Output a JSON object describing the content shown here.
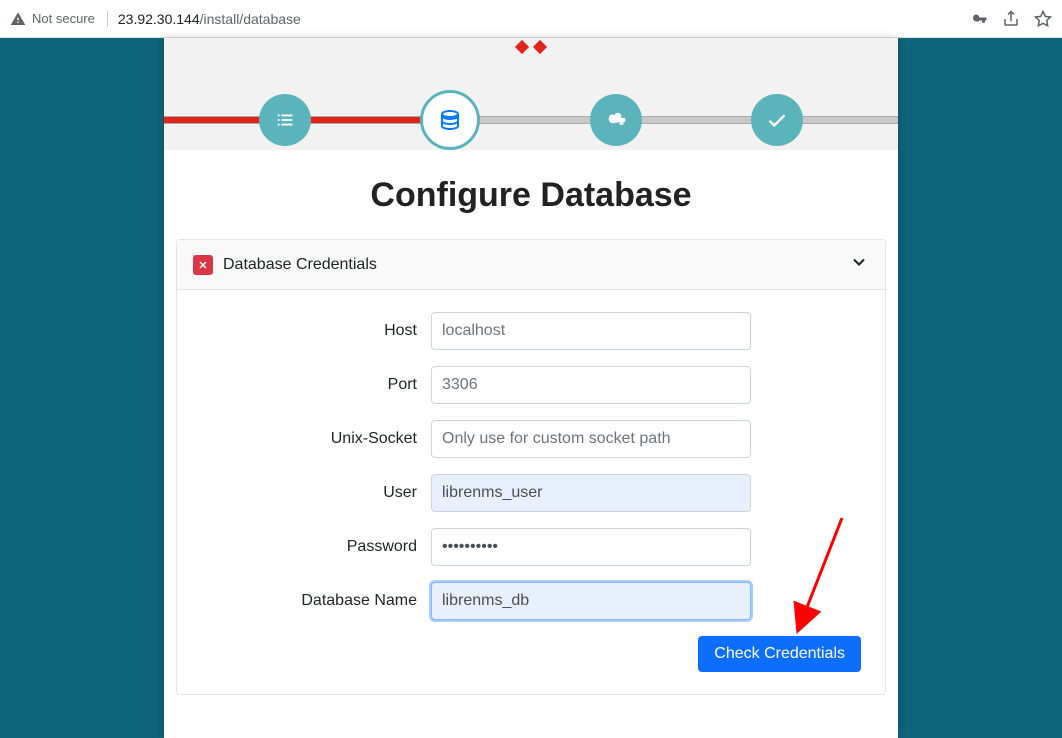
{
  "browser": {
    "security_text": "Not secure",
    "url_host": "23.92.30.144",
    "url_path": "/install/database"
  },
  "page": {
    "title": "Configure Database"
  },
  "panel": {
    "title": "Database Credentials"
  },
  "form": {
    "host": {
      "label": "Host",
      "placeholder": "localhost",
      "value": ""
    },
    "port": {
      "label": "Port",
      "placeholder": "3306",
      "value": ""
    },
    "unix_socket": {
      "label": "Unix-Socket",
      "placeholder": "Only use for custom socket path",
      "value": ""
    },
    "user": {
      "label": "User",
      "value": "librenms_user"
    },
    "password": {
      "label": "Password",
      "value": "••••••••••"
    },
    "database_name": {
      "label": "Database Name",
      "value": "librenms_db"
    }
  },
  "buttons": {
    "check_credentials": "Check Credentials"
  }
}
